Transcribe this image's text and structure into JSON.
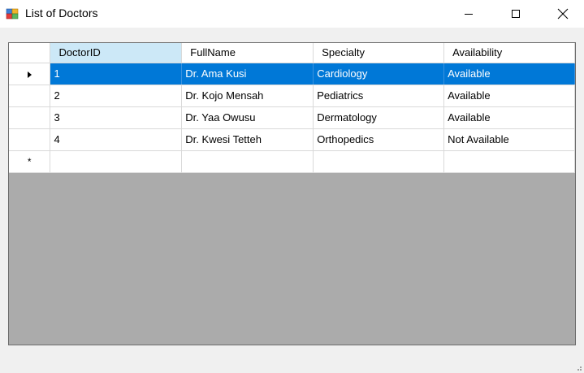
{
  "window": {
    "title": "List of Doctors",
    "minimize_icon": "minimize-icon",
    "maximize_icon": "maximize-icon",
    "close_icon": "close-icon"
  },
  "grid": {
    "columns": [
      "DoctorID",
      "FullName",
      "Specialty",
      "Availability"
    ],
    "rows": [
      {
        "id": "1",
        "name": "Dr. Ama Kusi",
        "specialty": "Cardiology",
        "availability": "Available"
      },
      {
        "id": "2",
        "name": "Dr. Kojo Mensah",
        "specialty": "Pediatrics",
        "availability": "Available"
      },
      {
        "id": "3",
        "name": "Dr. Yaa Owusu",
        "specialty": "Dermatology",
        "availability": "Available"
      },
      {
        "id": "4",
        "name": "Dr. Kwesi Tetteh",
        "specialty": "Orthopedics",
        "availability": "Not Available"
      }
    ],
    "selected_row": 0,
    "new_row_marker": "*",
    "colors": {
      "selection": "#0078d7",
      "header_highlight": "#cce8f7",
      "empty_area": "#ababab"
    }
  }
}
